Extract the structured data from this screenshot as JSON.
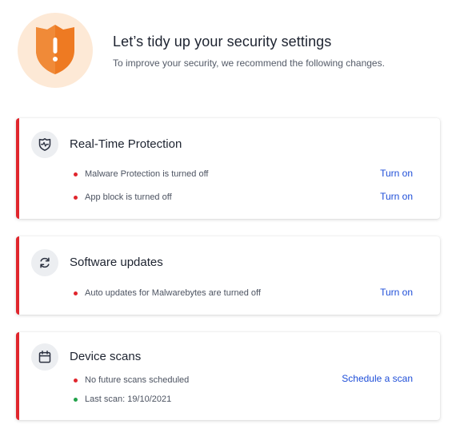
{
  "header": {
    "title": "Let’s tidy up your security settings",
    "subtitle": "To improve your security, we recommend the following changes.",
    "icon": "warning-shield-icon",
    "accent_color": "#ee7a22"
  },
  "colors": {
    "alert": "#e0262d",
    "ok": "#22a24a",
    "link": "#1e4ed8"
  },
  "cards": [
    {
      "title": "Real-Time Protection",
      "icon": "shield-pulse-icon",
      "issues": [
        {
          "text": "Malware Protection is turned off",
          "status": "alert",
          "action": "Turn on"
        },
        {
          "text": "App block is turned off",
          "status": "alert",
          "action": "Turn on"
        }
      ]
    },
    {
      "title": "Software updates",
      "icon": "refresh-icon",
      "issues": [
        {
          "text": "Auto updates for Malwarebytes are turned off",
          "status": "alert",
          "action": "Turn on"
        }
      ]
    },
    {
      "title": "Device scans",
      "icon": "calendar-icon",
      "issues": [
        {
          "text": "No future scans scheduled",
          "status": "alert",
          "action": "Schedule a scan"
        },
        {
          "text": "Last scan: 19/10/2021",
          "status": "ok"
        }
      ]
    }
  ]
}
